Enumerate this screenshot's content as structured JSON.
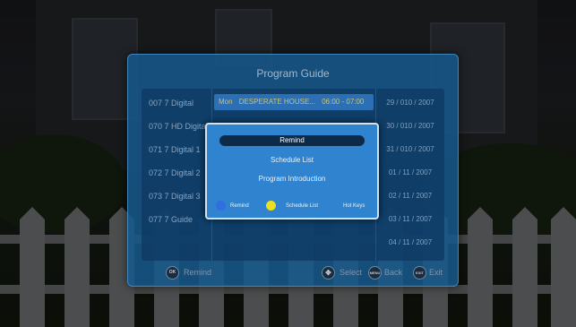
{
  "guide": {
    "title": "Program Guide",
    "channels": [
      "007  7 Digital",
      "070  7 HD Digital",
      "071  7 Digital 1",
      "072  7 Digital 2",
      "073  7 Digital 3",
      "077  7 Guide"
    ],
    "event": {
      "day": "Mon",
      "name": "DESPERATE HOUSE...",
      "time": "06:00 - 07:00"
    },
    "dates": [
      "29 / 010 / 2007",
      "30 / 010 / 2007",
      "31 / 010 / 2007",
      "01 / 11 / 2007",
      "02 / 11 / 2007",
      "03 / 11 / 2007",
      "04 / 11 / 2007"
    ],
    "footer": {
      "ok_key": "OK",
      "ok_label": "Remind",
      "select_label": "Select",
      "menu_key": "MENU",
      "back_label": "Back",
      "exit_key": "EXIT",
      "exit_label": "Exit"
    }
  },
  "popup": {
    "items": [
      "Remind",
      "Schedule List",
      "Program Introduction"
    ],
    "selected_index": 0,
    "footer": {
      "blue_label": "Remind",
      "yellow_label": "Schedule List",
      "hotkeys_label": "Hot Keys"
    }
  },
  "colors": {
    "blue_key": "#2f6fe0",
    "yellow_key": "#e8e020",
    "popup_bg": "#2f83cf",
    "selected_bg": "#0d2a48"
  }
}
